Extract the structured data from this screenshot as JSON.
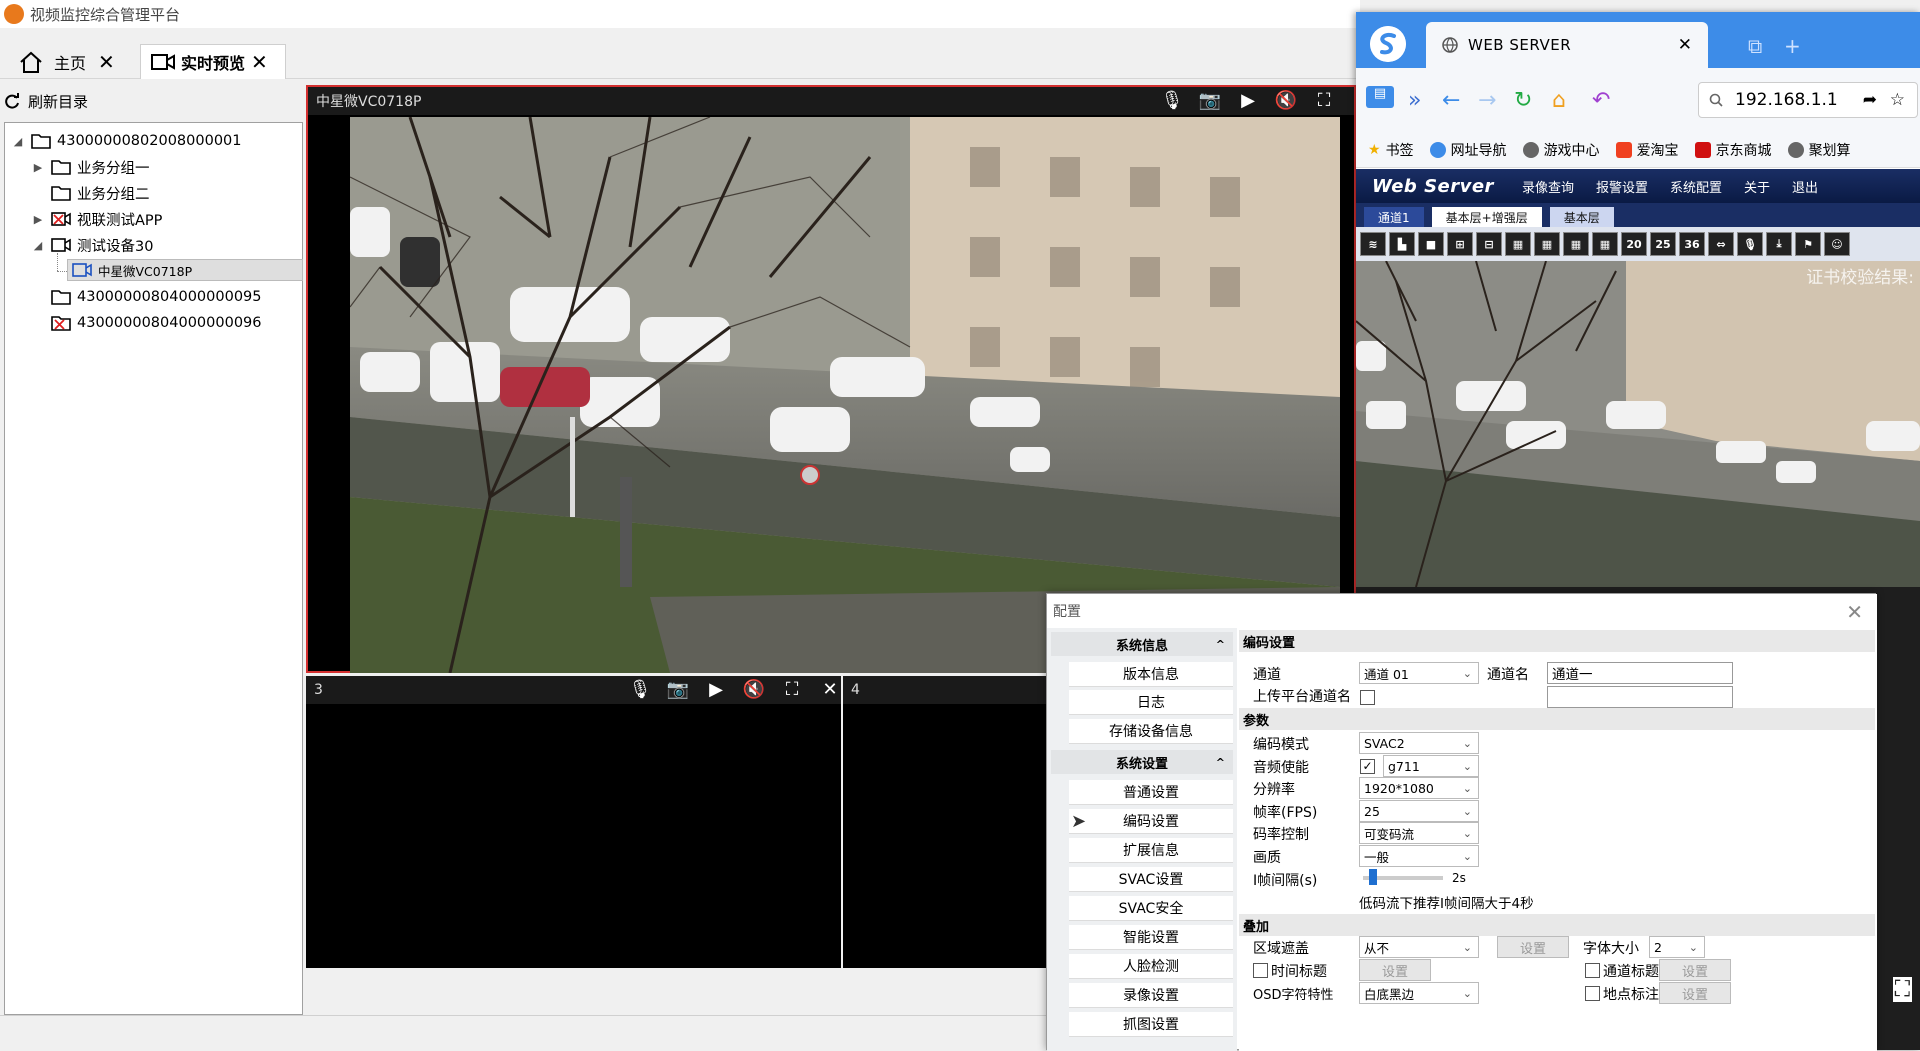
{
  "app": {
    "title": "视频监控综合管理平台"
  },
  "tabs": [
    {
      "label": "主页"
    },
    {
      "label": "实时预览"
    }
  ],
  "tree": {
    "refresh_label": "刷新目录",
    "nodes": [
      {
        "label": "43000000802008000001"
      },
      {
        "label": "业务分组一"
      },
      {
        "label": "业务分组二"
      },
      {
        "label": "视联测试APP"
      },
      {
        "label": "测试设备30"
      },
      {
        "label": "中星微VC0718P"
      },
      {
        "label": "43000000804000000095"
      },
      {
        "label": "43000000804000000096"
      }
    ]
  },
  "video": {
    "main_title": "中星微VC0718P",
    "pane3_title": "3",
    "pane4_title": "4",
    "controls": [
      "mic-off-icon",
      "camera-icon",
      "video-icon",
      "mute-icon",
      "fullscreen-icon",
      "close-icon"
    ]
  },
  "browser": {
    "tab_title": "WEB SERVER",
    "address": "192.168.1.1",
    "bookmarks": [
      "书签",
      "网址导航",
      "游戏中心",
      "爱淘宝",
      "京东商城",
      "聚划算"
    ],
    "web_server": {
      "logo": "Web Server",
      "menu": [
        "录像查询",
        "报警设置",
        "系统配置",
        "关于",
        "退出"
      ],
      "subtabs": [
        "通道1",
        "基本层+增强层",
        "基本层"
      ],
      "tool_numbers": [
        "20",
        "25",
        "36"
      ],
      "overlay_text": "证书校验结果:"
    }
  },
  "config": {
    "title": "配置",
    "groups": [
      {
        "label": "系统信息",
        "items": [
          "版本信息",
          "日志",
          "存储设备信息"
        ]
      },
      {
        "label": "系统设置",
        "items": [
          "普通设置",
          "编码设置",
          "扩展信息",
          "SVAC设置",
          "SVAC安全",
          "智能设置",
          "人脸检测",
          "录像设置",
          "抓图设置"
        ]
      }
    ],
    "section_encoding": "编码设置",
    "section_params": "参数",
    "section_overlay": "叠加",
    "channel_label": "通道",
    "channel_value": "通道 01",
    "channel_name_label": "通道名",
    "channel_name_value": "通道一",
    "upload_label": "上传平台通道名",
    "encode_mode_label": "编码模式",
    "encode_mode_value": "SVAC2",
    "audio_label": "音频使能",
    "audio_value": "g711",
    "resolution_label": "分辨率",
    "resolution_value": "1920*1080",
    "fps_label": "帧率(FPS)",
    "fps_value": "25",
    "bitrate_label": "码率控制",
    "bitrate_value": "可变码流",
    "quality_label": "画质",
    "quality_value": "一般",
    "iframe_label": "I帧间隔(s)",
    "iframe_value": "2s",
    "iframe_fraction": 0.12,
    "iframe_hint": "低码流下推荐I帧间隔大于4秒",
    "region_mask_label": "区域遮盖",
    "region_mask_value": "从不",
    "set_label": "设置",
    "font_size_label": "字体大小",
    "font_size_value": "2",
    "time_title_label": "时间标题",
    "channel_title_label": "通道标题",
    "osd_label": "OSD字符特性",
    "osd_value": "白底黑边",
    "location_label": "地点标注"
  }
}
